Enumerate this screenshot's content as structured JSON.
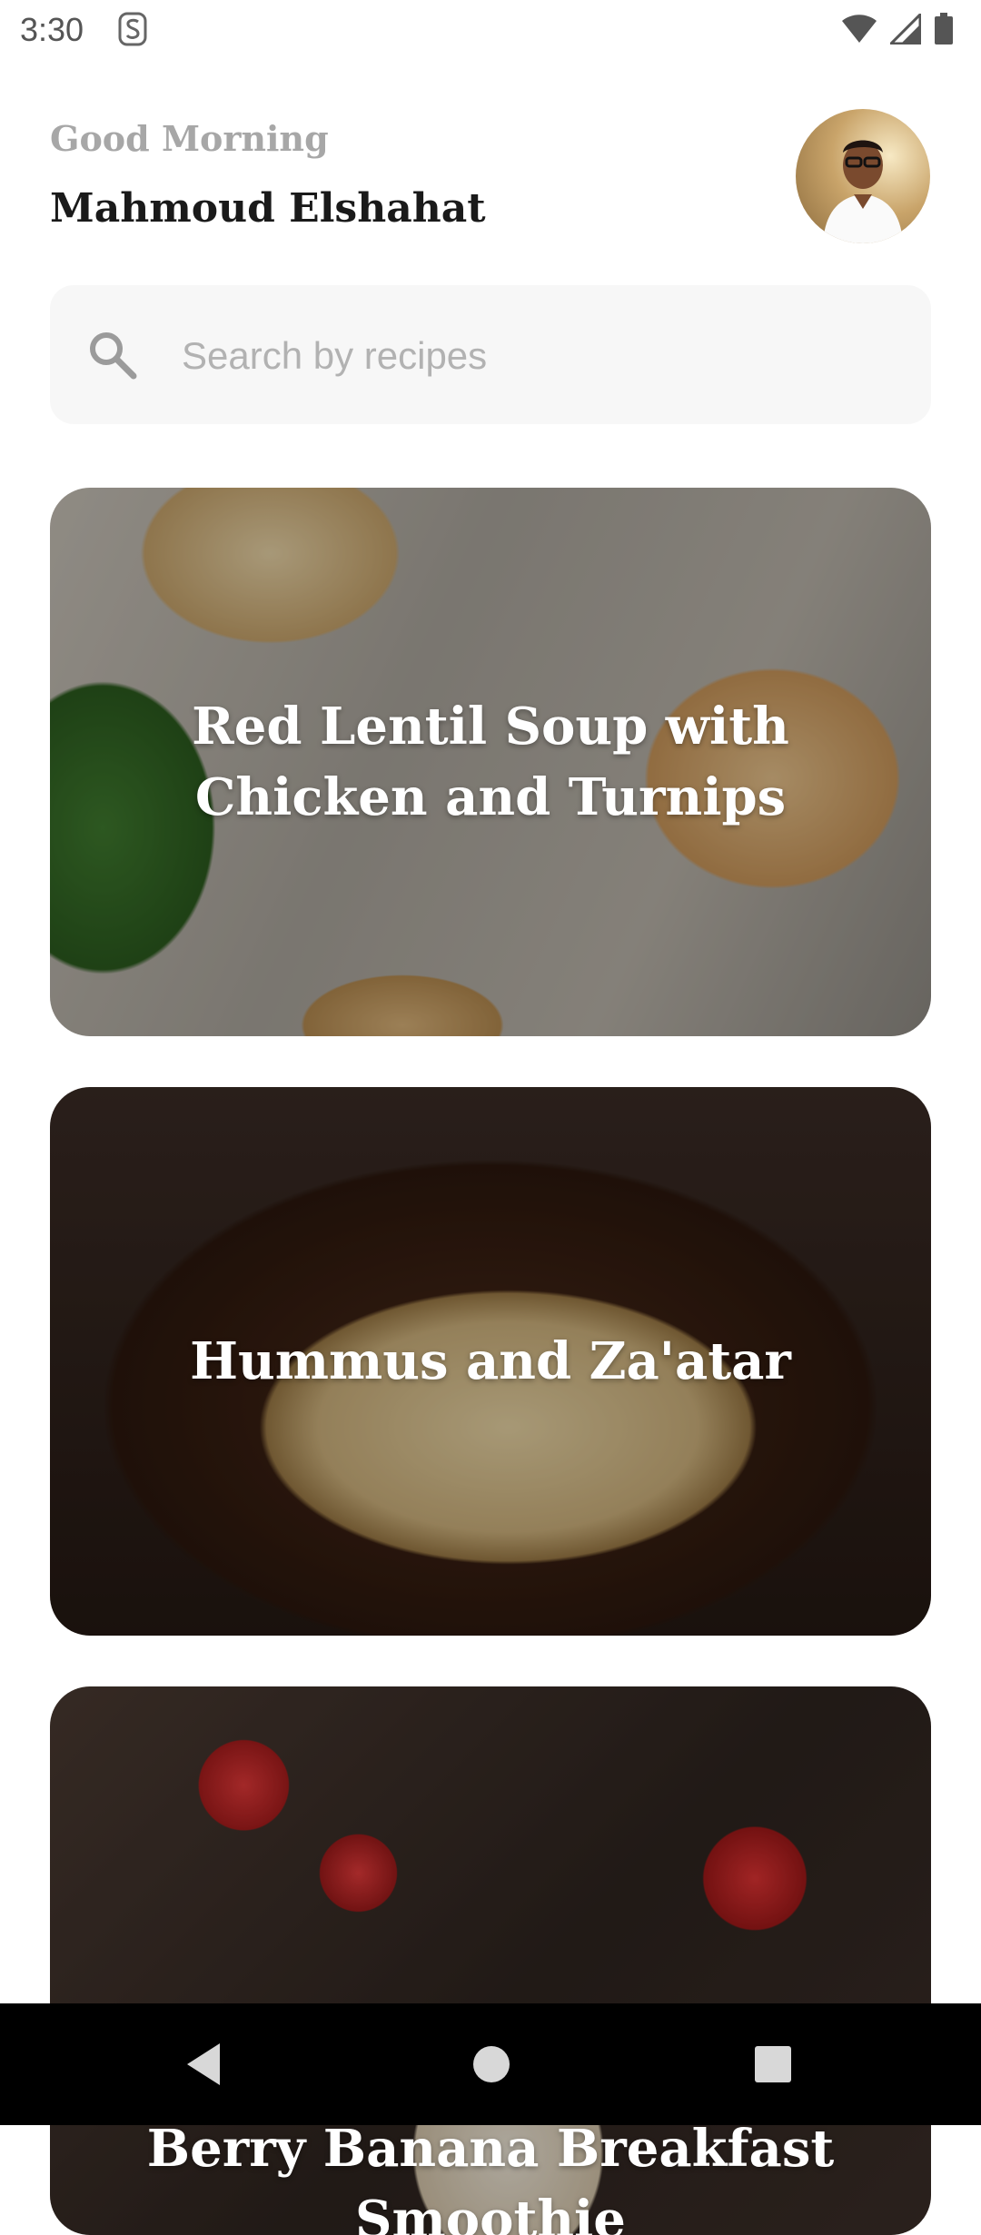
{
  "status_bar": {
    "time": "3:30",
    "icons": [
      "s-notification-icon",
      "wifi-icon",
      "cellular-signal-icon",
      "battery-icon"
    ]
  },
  "header": {
    "greeting": "Good Morning",
    "user_name": "Mahmoud Elshahat"
  },
  "search": {
    "placeholder": "Search by recipes",
    "value": ""
  },
  "recipes": [
    {
      "title": "Red Lentil Soup with Chicken and Turnips"
    },
    {
      "title": "Hummus and Za'atar"
    },
    {
      "title": "Berry Banana Breakfast Smoothie"
    }
  ],
  "navigation": {
    "buttons": [
      "back-icon",
      "home-icon",
      "recents-icon"
    ]
  },
  "colors": {
    "greeting": "#a7a7a7",
    "name": "#1a1a1a",
    "search_bg": "#f7f7f7",
    "placeholder": "#b2b2b2",
    "nav_bar": "#000000"
  }
}
